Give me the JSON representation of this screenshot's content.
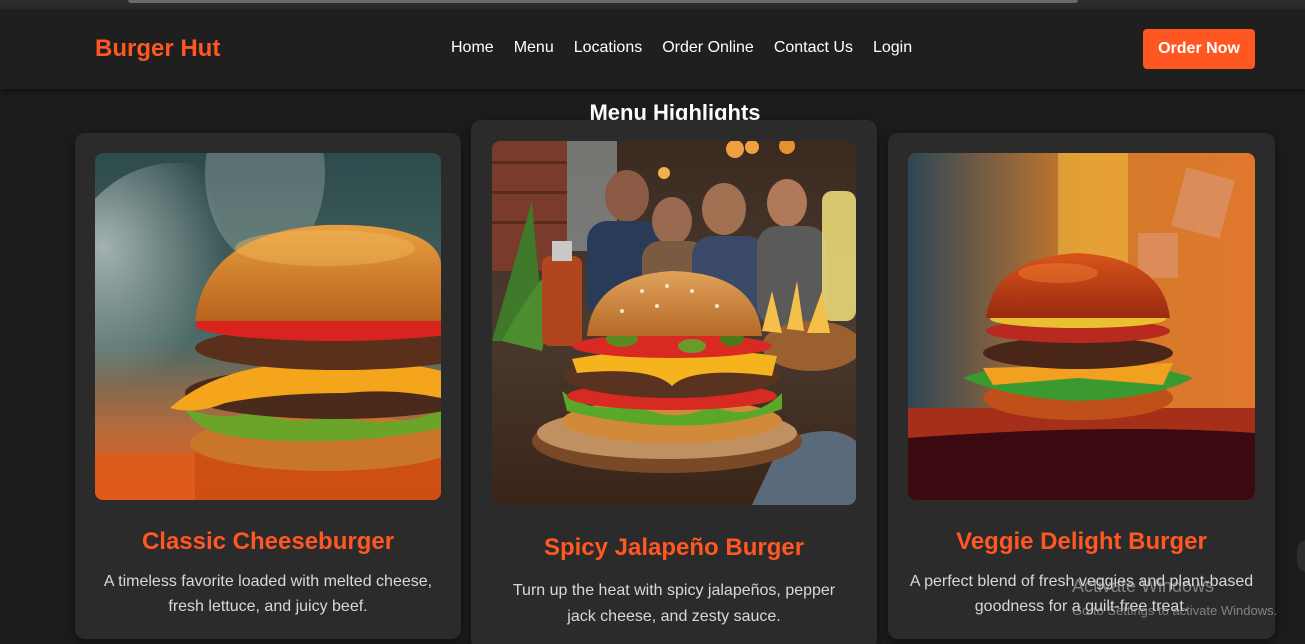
{
  "brand": {
    "name": "Burger Hut"
  },
  "nav": {
    "items": [
      {
        "label": "Home"
      },
      {
        "label": "Menu"
      },
      {
        "label": "Locations"
      },
      {
        "label": "Order Online"
      },
      {
        "label": "Contact Us"
      },
      {
        "label": "Login"
      }
    ],
    "cta_label": "Order Now"
  },
  "section": {
    "title": "Menu Highlights"
  },
  "cards": [
    {
      "title": "Classic Cheeseburger",
      "description_line1": "A timeless favorite loaded with melted cheese,",
      "description_line2": "fresh lettuce, and juicy beef."
    },
    {
      "title": "Spicy Jalapeño Burger",
      "description_line1": "Turn up the heat with spicy jalapeños, pepper",
      "description_line2": "jack cheese, and zesty sauce."
    },
    {
      "title": "Veggie Delight Burger",
      "description_line1": "A perfect blend of fresh veggies and plant-based",
      "description_line2": "goodness for a guilt-free treat."
    }
  ],
  "os_overlay": {
    "title": "Activate Windows",
    "subtitle": "Go to Settings to activate Windows."
  },
  "colors": {
    "accent": "#ff5722",
    "background": "#1c1c1c",
    "header": "#1f1f1f",
    "card": "#2b2b2b"
  }
}
